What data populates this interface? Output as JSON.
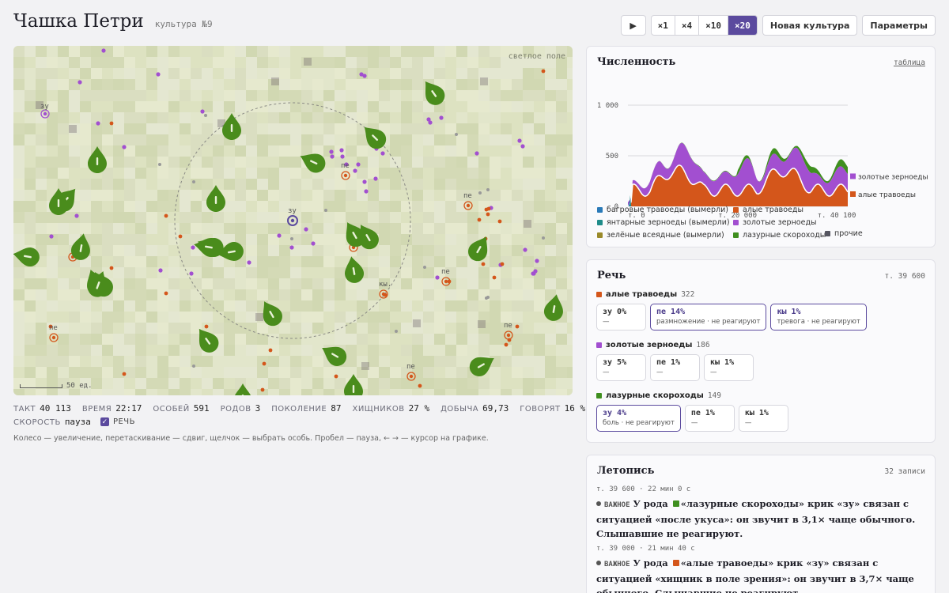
{
  "header": {
    "title": "Чашка Петри",
    "subtitle": "культура №9"
  },
  "toolbar": {
    "play_label": "▶",
    "speeds": [
      "×1",
      "×4",
      "×10",
      "×20"
    ],
    "active_speed": 3,
    "new_culture_label": "Новая культура",
    "settings_label": "Параметры"
  },
  "field": {
    "mode_label": "светлое поле",
    "scale_label": "50 ед.",
    "callouts": [
      "зу",
      "пе",
      "пе",
      "зу",
      "пе",
      "пе",
      "пе",
      "кы.",
      "пе",
      "пе",
      "пе"
    ]
  },
  "stats": [
    {
      "k": "ТАКТ",
      "v": "40 113"
    },
    {
      "k": "ВРЕМЯ",
      "v": "22:17"
    },
    {
      "k": "ОСОБЕЙ",
      "v": "591"
    },
    {
      "k": "РОДОВ",
      "v": "3"
    },
    {
      "k": "ПОКОЛЕНИЕ",
      "v": "87"
    },
    {
      "k": "ХИЩНИКОВ",
      "v": "27 %"
    },
    {
      "k": "ДОБЫЧА",
      "v": "69,73"
    },
    {
      "k": "ГОВОРЯТ",
      "v": "16 %"
    }
  ],
  "speed_label": "СКОРОСТЬ",
  "speed_value": "пауза",
  "speech_toggle_label": "РЕЧЬ",
  "hint": "Колесо — увеличение, перетаскивание — сдвиг, щелчок — выбрать особь. Пробел — пауза, ← → — курсор на графике.",
  "population": {
    "title": "Численность",
    "table_link": "таблица",
    "colors": {
      "orange": "#d4561b",
      "purple": "#a24fd0",
      "green": "#3f8f1f",
      "teal": "#1f8c8a",
      "blue": "#2a7ab8"
    },
    "chart_data": {
      "type": "area",
      "x_ticks": [
        "т. 0",
        "т. 20 000",
        "т. 40 100"
      ],
      "y_ticks": [
        "0",
        "500",
        "1 000"
      ],
      "xlim": [
        0,
        40100
      ],
      "ylim": [
        0,
        1000
      ],
      "series_end_labels": [
        "золотые зерноеды",
        "алые травоеды"
      ]
    },
    "legend": [
      {
        "name": "багровые травоеды",
        "note": "(вымерли)",
        "color": "#2a7ab8"
      },
      {
        "name": "алые травоеды",
        "note": "",
        "color": "#d4561b"
      },
      {
        "name": "янтарные зерноеды",
        "note": "(вымерли)",
        "color": "#1f8c8a"
      },
      {
        "name": "золотые зерноеды",
        "note": "",
        "color": "#a24fd0"
      },
      {
        "name": "зелёные всеядные",
        "note": "(вымерли)",
        "color": "#9a8a2a"
      },
      {
        "name": "лазурные скороходы",
        "note": "",
        "color": "#3f8f1f"
      },
      {
        "name": "прочие",
        "note": "",
        "color": "#555560"
      }
    ]
  },
  "speech": {
    "title": "Речь",
    "tick": "т. 39 600",
    "groups": [
      {
        "name": "алые травоеды",
        "count": "322",
        "color": "#d4561b",
        "cards": [
          {
            "word": "зу 0%",
            "desc": "—",
            "hl": false
          },
          {
            "word": "пе 14%",
            "desc": "размножение · не реагируют",
            "hl": true
          },
          {
            "word": "кы 1%",
            "desc": "тревога · не реагируют",
            "hl": true
          }
        ]
      },
      {
        "name": "золотые зерноеды",
        "count": "186",
        "color": "#a24fd0",
        "cards": [
          {
            "word": "зу 5%",
            "desc": "—",
            "hl": false
          },
          {
            "word": "пе 1%",
            "desc": "—",
            "hl": false
          },
          {
            "word": "кы 1%",
            "desc": "—",
            "hl": false
          }
        ]
      },
      {
        "name": "лазурные скороходы",
        "count": "149",
        "color": "#3f8f1f",
        "cards": [
          {
            "word": "зу 4%",
            "desc": "боль · не реагируют",
            "hl": true
          },
          {
            "word": "пе 1%",
            "desc": "—",
            "hl": false
          },
          {
            "word": "кы 1%",
            "desc": "—",
            "hl": false
          }
        ]
      }
    ]
  },
  "chronicle": {
    "title": "Летопись",
    "count": "32 записи",
    "entries": [
      {
        "meta": "т. 39 600 · 22 мин 0 с",
        "important": "ВАЖНОЕ",
        "pre": "У рода",
        "color": "#3f8f1f",
        "text": "«лазурные скороходы» крик «зу» связан с ситуацией «после укуса»: он звучит в 3,1× чаще обычного. Слышавшие не реагируют."
      },
      {
        "meta": "т. 39 000 · 21 мин 40 с",
        "important": "ВАЖНОЕ",
        "pre": "У рода",
        "color": "#d4561b",
        "text": "«алые травоеды» крик «зу» связан с ситуацией «хищник в поле зрения»: он звучит в 3,7× чаще обычного. Слышавшие не реагируют."
      }
    ]
  }
}
